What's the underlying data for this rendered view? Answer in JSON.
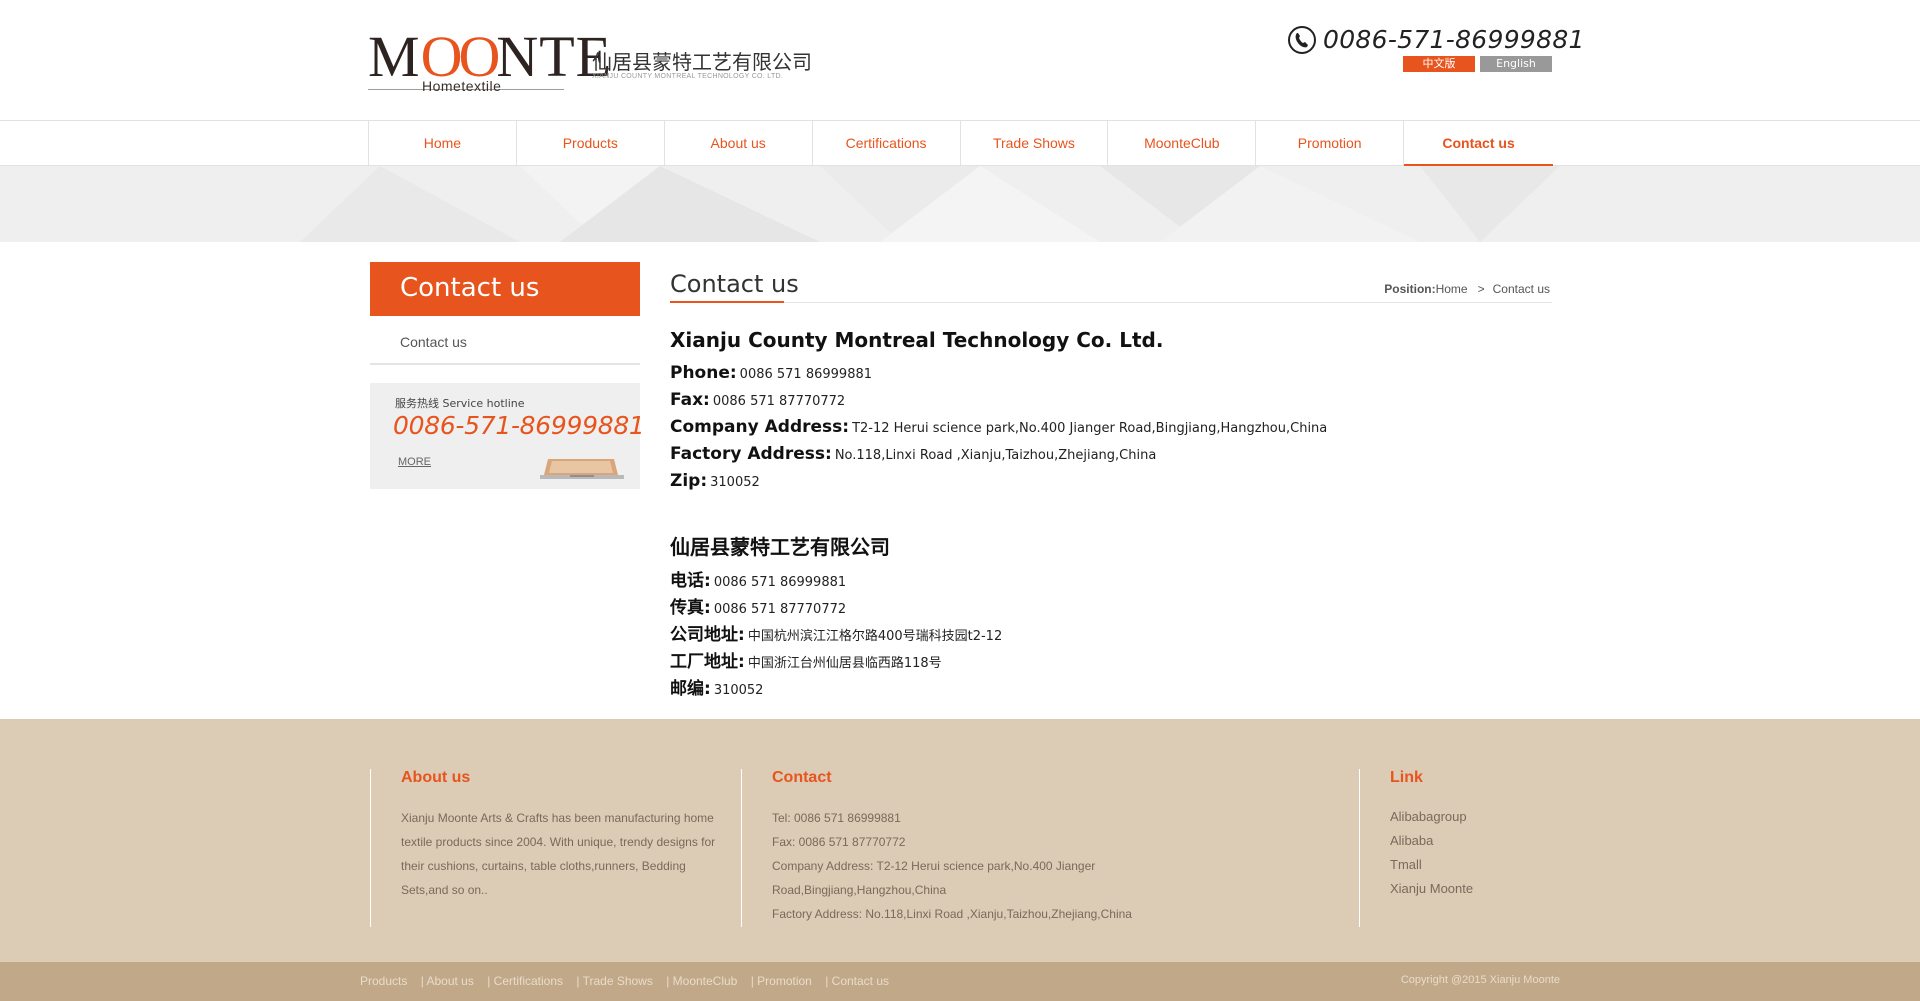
{
  "header": {
    "logo_text": "MOONTE",
    "logo_subtext": "Hometextile",
    "company_cn": "仙居县蒙特工艺有限公司",
    "company_en": "XIANJU COUNTY MONTREAL TECHNOLOGY CO. LTD.",
    "phone": "0086-571-86999881",
    "lang_cn": "中文版",
    "lang_en": "English"
  },
  "nav": {
    "items": [
      {
        "label": "Home"
      },
      {
        "label": "Products"
      },
      {
        "label": "About us"
      },
      {
        "label": "Certifications"
      },
      {
        "label": "Trade Shows"
      },
      {
        "label": "MoonteClub"
      },
      {
        "label": "Promotion"
      },
      {
        "label": "Contact us"
      }
    ],
    "active": "Contact us"
  },
  "sidebar": {
    "title": "Contact us",
    "items": [
      {
        "label": "Contact us"
      }
    ],
    "hotline_label": "服务热线 Service hotline",
    "hotline_number": "0086-571-86999881",
    "more_label": "MORE"
  },
  "main": {
    "title": "Contact us",
    "position_label": "Position:",
    "breadcrumb_home": "Home",
    "breadcrumb_sep": ">",
    "breadcrumb_current": "Contact us",
    "en": {
      "company": "Xianju County Montreal Technology Co. Ltd.",
      "phone_key": "Phone:",
      "phone_val": "0086 571 86999881",
      "fax_key": "Fax:",
      "fax_val": "0086 571 87770772",
      "address_key": "Company Address:",
      "address_val": "T2-12 Herui science park,No.400 Jianger Road,Bingjiang,Hangzhou,China",
      "factory_key": "Factory Address:",
      "factory_val": "No.118,Linxi Road ,Xianju,Taizhou,Zhejiang,China",
      "zip_key": "Zip:",
      "zip_val": "310052"
    },
    "cn": {
      "company": "仙居县蒙特工艺有限公司",
      "phone_key": "电话:",
      "phone_val": "0086 571 86999881",
      "fax_key": "传真:",
      "fax_val": "0086 571 87770772",
      "address_key": "公司地址:",
      "address_val": "中国杭州滨江江格尔路400号瑞科技园t2-12",
      "factory_key": "工厂地址:",
      "factory_val": "中国浙江台州仙居县临西路118号",
      "zip_key": "邮编:",
      "zip_val": "310052"
    }
  },
  "footer": {
    "about_title": "About us",
    "about_text": "Xianju Moonte Arts & Crafts has been manufacturing home textile products since 2004. With unique, trendy designs for their cushions, curtains, table cloths,runners, Bedding Sets,and so on..",
    "contact_title": "Contact",
    "contact_lines": [
      "Tel: 0086 571 86999881",
      "Fax: 0086 571 87770772",
      "Company Address: T2-12 Herui science park,No.400 Jianger Road,Bingjiang,Hangzhou,China",
      "Factory Address: No.118,Linxi Road ,Xianju,Taizhou,Zhejiang,China"
    ],
    "link_title": "Link",
    "links": [
      "Alibabagroup",
      "Alibaba",
      "Tmall",
      "Xianju Moonte"
    ],
    "bottom_links": [
      "Products",
      "| About us",
      "| Certifications",
      "| Trade Shows",
      "| MoonteClub",
      "| Promotion",
      "| Contact us"
    ],
    "copyright": "Copyright @2015 Xianju Moonte"
  },
  "colors": {
    "accent": "#e8541d",
    "footer_bg": "#dccbb5",
    "bottom_bar": "#c1a888"
  }
}
